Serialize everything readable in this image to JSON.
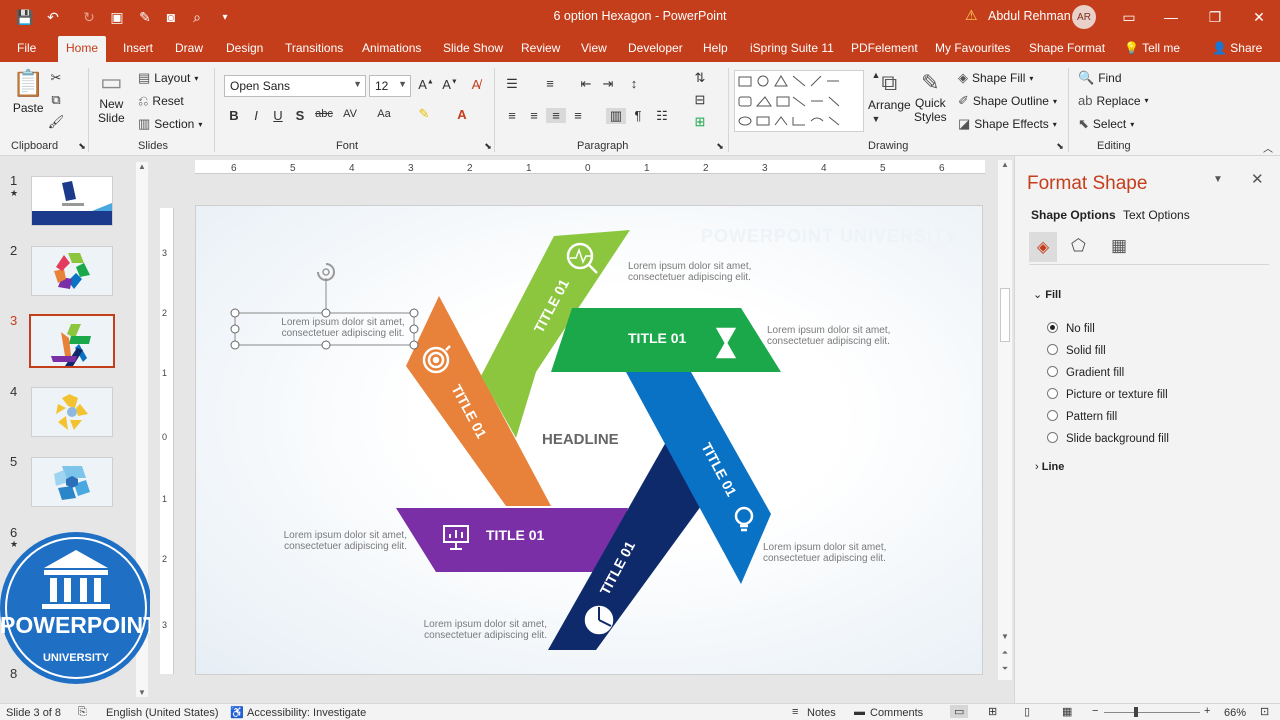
{
  "window": {
    "title": "6 option Hexagon  -  PowerPoint",
    "user": "Abdul Rehman",
    "avatar": "AR"
  },
  "tabs": [
    "File",
    "Home",
    "Insert",
    "Draw",
    "Design",
    "Transitions",
    "Animations",
    "Slide Show",
    "Review",
    "View",
    "Developer",
    "Help",
    "iSpring Suite 11",
    "PDFelement",
    "My Favourites",
    "Shape Format",
    "Tell me",
    "Share"
  ],
  "ribbon": {
    "clipboard": {
      "paste": "Paste",
      "label": "Clipboard"
    },
    "slides": {
      "new_slide": "New",
      "new_slide2": "Slide",
      "layout": "Layout",
      "reset": "Reset",
      "section": "Section",
      "label": "Slides"
    },
    "font": {
      "name": "Open Sans",
      "size": "12",
      "label": "Font"
    },
    "paragraph": {
      "label": "Paragraph"
    },
    "drawing": {
      "arrange": "Arrange",
      "quick": "Quick",
      "styles": "Styles",
      "shape_fill": "Shape Fill",
      "shape_outline": "Shape Outline",
      "shape_effects": "Shape Effects",
      "label": "Drawing"
    },
    "editing": {
      "find": "Find",
      "replace": "Replace",
      "select": "Select",
      "label": "Editing"
    }
  },
  "thumbnails": [
    "1",
    "2",
    "3",
    "4",
    "5",
    "6",
    "8"
  ],
  "slide": {
    "headline": "HEADLINE",
    "watermark": "POWERPOINT UNIVERSITY",
    "titles": [
      "TITLE 01",
      "TITLE 01",
      "TITLE 01",
      "TITLE 01",
      "TITLE 01",
      "TITLE 01"
    ],
    "lorem1": "Lorem ipsum dolor sit amet,",
    "lorem2": "consectetuer adipiscing elit.",
    "colors": {
      "green": "#8cc63f",
      "dkgreen": "#1aa84a",
      "blue": "#0a72c4",
      "navy": "#0f2a6b",
      "purple": "#7b2fa6",
      "orange": "#e8813a"
    }
  },
  "pane": {
    "title": "Format Shape",
    "tab1": "Shape Options",
    "tab2": "Text Options",
    "fill_section": "Fill",
    "fill_options": [
      "No fill",
      "Solid fill",
      "Gradient fill",
      "Picture or texture fill",
      "Pattern fill",
      "Slide background fill"
    ],
    "line_section": "Line"
  },
  "status": {
    "slide": "Slide 3 of 8",
    "language": "English (United States)",
    "accessibility": "Accessibility: Investigate",
    "notes": "Notes",
    "comments": "Comments",
    "zoom": "66%"
  },
  "logo": {
    "text": "POWERPOINT",
    "sub": "UNIVERSITY"
  }
}
